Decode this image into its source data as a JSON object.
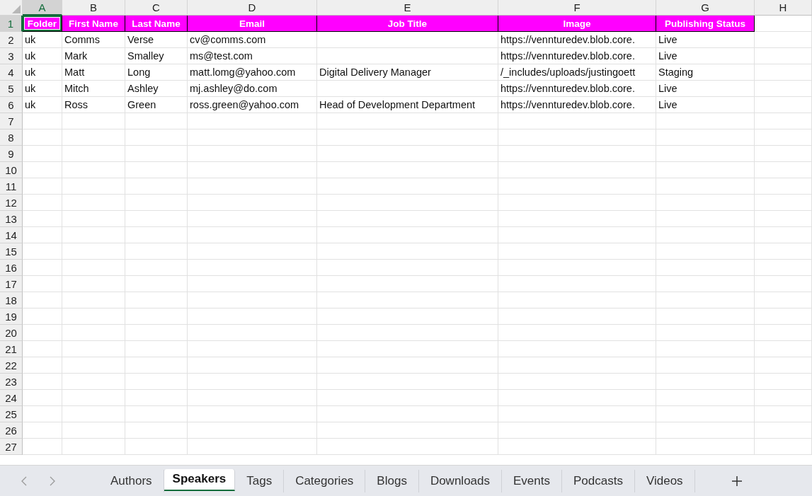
{
  "sheet": {
    "columns": [
      {
        "letter": "A",
        "selected": true
      },
      {
        "letter": "B",
        "selected": false
      },
      {
        "letter": "C",
        "selected": false
      },
      {
        "letter": "D",
        "selected": false
      },
      {
        "letter": "E",
        "selected": false
      },
      {
        "letter": "F",
        "selected": false
      },
      {
        "letter": "G",
        "selected": false
      },
      {
        "letter": "H",
        "selected": false
      }
    ],
    "rows": [
      {
        "number": "1",
        "selected": true,
        "kind": "header",
        "cells": [
          "Folder",
          "First Name",
          "Last Name",
          "Email",
          "Job Title",
          "Image",
          "Publishing Status",
          null
        ]
      },
      {
        "number": "2",
        "selected": false,
        "kind": "data",
        "cells": [
          "uk",
          "Comms",
          "Verse",
          "cv@comms.com",
          null,
          "https://vennturedev.blob.core.",
          "Live",
          null
        ]
      },
      {
        "number": "3",
        "selected": false,
        "kind": "data",
        "cells": [
          "uk",
          "Mark",
          "Smalley",
          "ms@test.com",
          null,
          "https://vennturedev.blob.core.",
          "Live",
          null
        ]
      },
      {
        "number": "4",
        "selected": false,
        "kind": "data",
        "cells": [
          "uk",
          "Matt",
          "Long",
          "matt.lomg@yahoo.com",
          "Digital Delivery Manager",
          "/_includes/uploads/justingoett",
          "Staging",
          null
        ]
      },
      {
        "number": "5",
        "selected": false,
        "kind": "data",
        "cells": [
          "uk",
          "Mitch",
          "Ashley",
          "mj.ashley@do.com",
          null,
          "https://vennturedev.blob.core.",
          "Live",
          null
        ]
      },
      {
        "number": "6",
        "selected": false,
        "kind": "data",
        "cells": [
          "uk",
          "Ross",
          "Green",
          "ross.green@yahoo.com",
          "Head of Development Department",
          "https://vennturedev.blob.core.",
          "Live",
          null
        ]
      },
      {
        "number": "7",
        "selected": false,
        "kind": "data"
      },
      {
        "number": "8",
        "selected": false,
        "kind": "data"
      },
      {
        "number": "9",
        "selected": false,
        "kind": "data"
      },
      {
        "number": "10",
        "selected": false,
        "kind": "data"
      },
      {
        "number": "11",
        "selected": false,
        "kind": "data"
      },
      {
        "number": "12",
        "selected": false,
        "kind": "data"
      },
      {
        "number": "13",
        "selected": false,
        "kind": "data"
      },
      {
        "number": "14",
        "selected": false,
        "kind": "data"
      },
      {
        "number": "15",
        "selected": false,
        "kind": "data"
      },
      {
        "number": "16",
        "selected": false,
        "kind": "data"
      },
      {
        "number": "17",
        "selected": false,
        "kind": "data"
      },
      {
        "number": "18",
        "selected": false,
        "kind": "data"
      },
      {
        "number": "19",
        "selected": false,
        "kind": "data"
      },
      {
        "number": "20",
        "selected": false,
        "kind": "data"
      },
      {
        "number": "21",
        "selected": false,
        "kind": "data"
      },
      {
        "number": "22",
        "selected": false,
        "kind": "data"
      },
      {
        "number": "23",
        "selected": false,
        "kind": "data"
      },
      {
        "number": "24",
        "selected": false,
        "kind": "data"
      },
      {
        "number": "25",
        "selected": false,
        "kind": "data"
      },
      {
        "number": "26",
        "selected": false,
        "kind": "data"
      },
      {
        "number": "27",
        "selected": false,
        "kind": "data"
      }
    ]
  },
  "sheet_tabs": [
    {
      "label": "Authors",
      "selected": false
    },
    {
      "label": "Speakers",
      "selected": true
    },
    {
      "label": "Tags",
      "selected": false
    },
    {
      "label": "Categories",
      "selected": false
    },
    {
      "label": "Blogs",
      "selected": false
    },
    {
      "label": "Downloads",
      "selected": false
    },
    {
      "label": "Events",
      "selected": false
    },
    {
      "label": "Podcasts",
      "selected": false
    },
    {
      "label": "Videos",
      "selected": false
    }
  ]
}
